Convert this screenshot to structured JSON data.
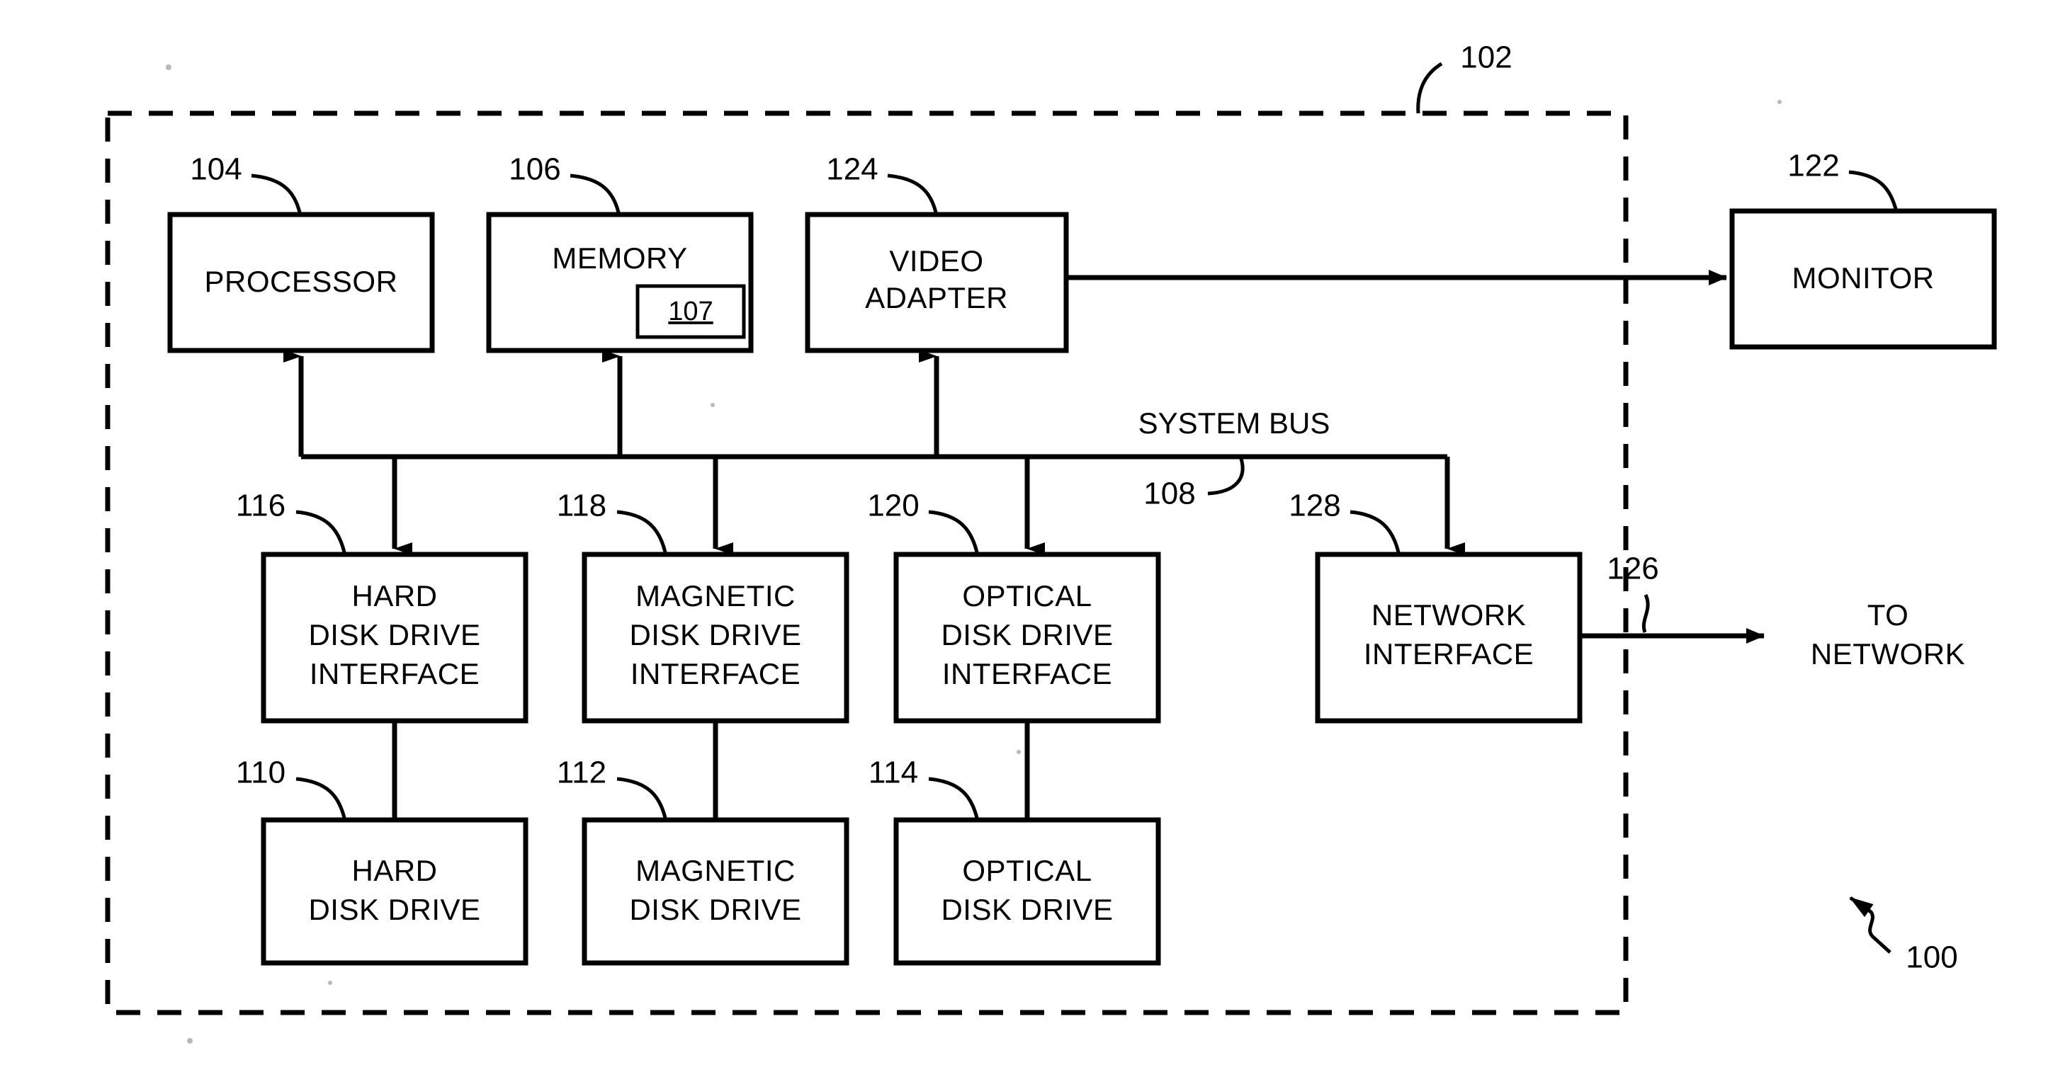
{
  "figure": {
    "type": "patent-block-diagram",
    "overall_ref": "100",
    "enclosure_ref": "102",
    "enclosure_style": "dashed"
  },
  "blocks": {
    "processor": {
      "ref": "104",
      "lines": [
        "PROCESSOR"
      ]
    },
    "memory": {
      "ref": "106",
      "lines": [
        "MEMORY"
      ],
      "inner_ref": "107"
    },
    "video_adapter": {
      "ref": "124",
      "lines": [
        "VIDEO",
        "ADAPTER"
      ]
    },
    "monitor": {
      "ref": "122",
      "lines": [
        "MONITOR"
      ]
    },
    "hard_disk_drive_interface": {
      "ref": "116",
      "lines": [
        "HARD",
        "DISK DRIVE",
        "INTERFACE"
      ]
    },
    "magnetic_disk_drive_interface": {
      "ref": "118",
      "lines": [
        "MAGNETIC",
        "DISK DRIVE",
        "INTERFACE"
      ]
    },
    "optical_disk_drive_interface": {
      "ref": "120",
      "lines": [
        "OPTICAL",
        "DISK DRIVE",
        "INTERFACE"
      ]
    },
    "network_interface": {
      "ref": "128",
      "lines": [
        "NETWORK",
        "INTERFACE"
      ]
    },
    "hard_disk_drive": {
      "ref": "110",
      "lines": [
        "HARD",
        "DISK DRIVE"
      ]
    },
    "magnetic_disk_drive": {
      "ref": "112",
      "lines": [
        "MAGNETIC",
        "DISK DRIVE"
      ]
    },
    "optical_disk_drive": {
      "ref": "114",
      "lines": [
        "OPTICAL",
        "DISK DRIVE"
      ]
    }
  },
  "bus": {
    "label": "SYSTEM BUS",
    "ref": "108"
  },
  "external": {
    "network_link_ref": "126",
    "network_destination_lines": [
      "TO",
      "NETWORK"
    ]
  },
  "colors": {
    "ink": "#000000",
    "paper": "#ffffff"
  }
}
